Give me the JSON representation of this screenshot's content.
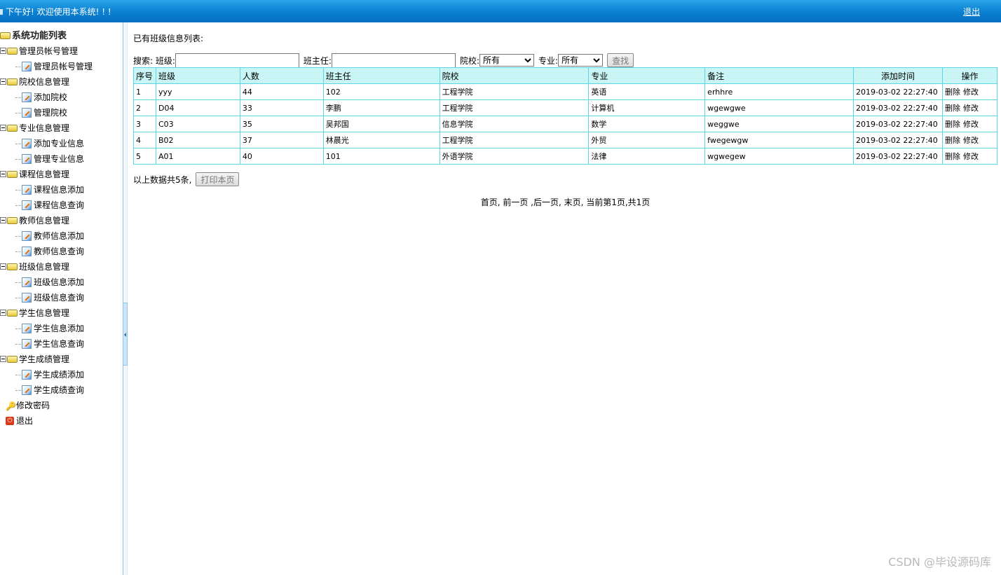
{
  "header": {
    "welcome": "下午好! 欢迎使用本系统! ! !",
    "logout": "退出"
  },
  "sidebar": {
    "root": "系统功能列表",
    "groups": [
      {
        "label": "管理员帐号管理",
        "items": [
          "管理员帐号管理"
        ]
      },
      {
        "label": "院校信息管理",
        "items": [
          "添加院校",
          "管理院校"
        ]
      },
      {
        "label": "专业信息管理",
        "items": [
          "添加专业信息",
          "管理专业信息"
        ]
      },
      {
        "label": "课程信息管理",
        "items": [
          "课程信息添加",
          "课程信息查询"
        ]
      },
      {
        "label": "教师信息管理",
        "items": [
          "教师信息添加",
          "教师信息查询"
        ]
      },
      {
        "label": "班级信息管理",
        "items": [
          "班级信息添加",
          "班级信息查询"
        ]
      },
      {
        "label": "学生信息管理",
        "items": [
          "学生信息添加",
          "学生信息查询"
        ]
      },
      {
        "label": "学生成绩管理",
        "items": [
          "学生成绩添加",
          "学生成绩查询"
        ]
      }
    ],
    "change_password": "修改密码",
    "exit": "退出"
  },
  "main": {
    "title": "已有班级信息列表:",
    "search": {
      "label": "搜索:",
      "class_label": "班级:",
      "class_value": "",
      "teacher_label": "班主任:",
      "teacher_value": "",
      "school_label": "院校:",
      "school_selected": "所有",
      "major_label": "专业:",
      "major_selected": "所有",
      "search_button": "查找"
    },
    "table": {
      "headers": [
        "序号",
        "班级",
        "人数",
        "班主任",
        "院校",
        "专业",
        "备注",
        "添加时间",
        "操作"
      ],
      "rows": [
        {
          "no": "1",
          "class": "yyy",
          "count": "44",
          "teacher": "102",
          "school": "工程学院",
          "major": "英语",
          "note": "erhhre",
          "time": "2019-03-02 22:27:40"
        },
        {
          "no": "2",
          "class": "D04",
          "count": "33",
          "teacher": "李鹏",
          "school": "工程学院",
          "major": "计算机",
          "note": "wgewgwe",
          "time": "2019-03-02 22:27:40"
        },
        {
          "no": "3",
          "class": "C03",
          "count": "35",
          "teacher": "吴邦国",
          "school": "信息学院",
          "major": "数学",
          "note": "weggwe",
          "time": "2019-03-02 22:27:40"
        },
        {
          "no": "4",
          "class": "B02",
          "count": "37",
          "teacher": "林晨光",
          "school": "工程学院",
          "major": "外贸",
          "note": "fwegewgw",
          "time": "2019-03-02 22:27:40"
        },
        {
          "no": "5",
          "class": "A01",
          "count": "40",
          "teacher": "101",
          "school": "外语学院",
          "major": "法律",
          "note": "wgwegew",
          "time": "2019-03-02 22:27:40"
        }
      ],
      "delete_label": "删除",
      "edit_label": "修改"
    },
    "summary": "以上数据共5条,",
    "print_button": "打印本页",
    "pager": "首页, 前一页 ,后一页, 末页, 当前第1页,共1页"
  },
  "watermark": "CSDN @毕设源码库"
}
